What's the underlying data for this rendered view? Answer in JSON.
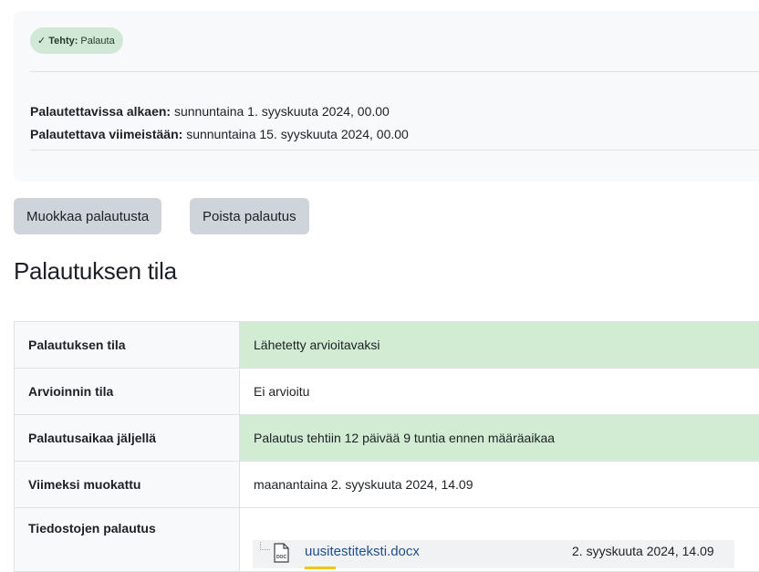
{
  "activity": {
    "badge_prefix": "Tehty:",
    "badge_value": "Palauta",
    "opens_label": "Palautettavissa alkaen:",
    "opens_value": "sunnuntaina 1. syyskuuta 2024, 00.00",
    "due_label": "Palautettava viimeistään:",
    "due_value": "sunnuntaina 15. syyskuuta 2024, 00.00"
  },
  "actions": {
    "edit_label": "Muokkaa palautusta",
    "remove_label": "Poista palautus"
  },
  "section_title": "Palautuksen tila",
  "rows": [
    {
      "label": "Palautuksen tila",
      "value": "Lähetetty arvioitavaksi"
    },
    {
      "label": "Arvioinnin tila",
      "value": "Ei arvioitu"
    },
    {
      "label": "Palautusaikaa jäljellä",
      "value": "Palautus tehtiin 12 päivää 9 tuntia ennen määräaikaa"
    },
    {
      "label": "Viimeksi muokattu",
      "value": "maanantaina 2. syyskuuta 2024, 14.09"
    },
    {
      "label": "Tiedostojen palautus",
      "value": ""
    }
  ],
  "file": {
    "name": "uusitestiteksti.docx",
    "date": "2. syyskuuta 2024, 14.09",
    "icon_text": "DOC"
  },
  "colors": {
    "success_bg": "#d2ecd3",
    "badge_bg": "#d2e8d6",
    "button_bg": "#ced4da",
    "link": "#1f4f8b"
  }
}
